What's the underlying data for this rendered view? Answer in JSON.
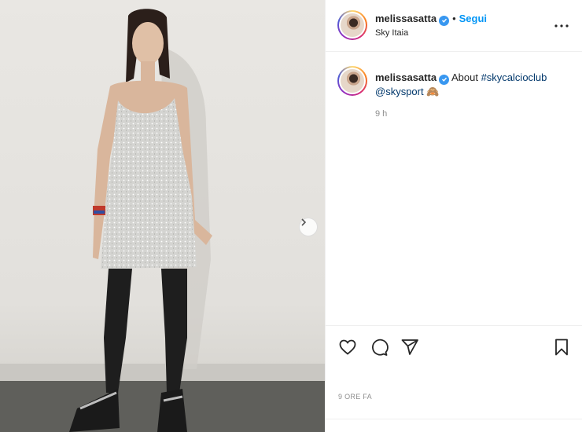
{
  "post": {
    "photo_alt": "Woman in silver sequin mini dress",
    "carousel_next_icon": "chevron-right-icon"
  },
  "header": {
    "username": "melissasatta",
    "separator": "•",
    "follow_label": "Segui",
    "location": "Sky Itaia",
    "more_icon": "more-horizontal-icon"
  },
  "caption": {
    "username": "melissasatta",
    "text_prefix": "About",
    "hashtag": "#skycalcioclub",
    "mention": "@skysport",
    "emoji": "🙈",
    "time_ago": "9 h"
  },
  "actions": {
    "like_icon": "heart-icon",
    "comment_icon": "comment-icon",
    "share_icon": "share-icon",
    "save_icon": "bookmark-icon"
  },
  "post_date": "9 ORE FA",
  "colors": {
    "link_blue": "#0095f6",
    "verified_blue": "#3897f0",
    "hashtag_blue": "#00376b",
    "muted_gray": "#8e8e8e"
  }
}
